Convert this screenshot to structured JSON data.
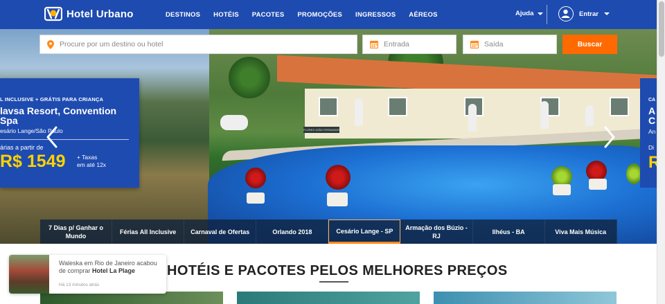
{
  "header": {
    "logo_text": "Hotel Urbano",
    "nav": [
      "DESTINOS",
      "HOTÉIS",
      "PACOTES",
      "PROMOÇÕES",
      "INGRESSOS",
      "AÉREOS"
    ],
    "help_label": "Ajuda",
    "login_label": "Entrar"
  },
  "search": {
    "destination_placeholder": "Procure por um destino ou hotel",
    "checkin_placeholder": "Entrada",
    "checkout_placeholder": "Saída",
    "button_label": "Buscar"
  },
  "promo": {
    "tag": "L INCLUSIVE + GRÁTIS PARA CRIANÇA",
    "name": "lavsa Resort, Convention Spa",
    "location": "esário Lange/São Paulo",
    "from_label": "árias a partir de",
    "price": "R$ 1549",
    "tax_line1": "+ Taxas",
    "tax_line2": "em até 12x"
  },
  "promo_next": {
    "tag": "CA",
    "name": "A C",
    "location": "An",
    "from_label": "Di",
    "price": "R"
  },
  "dest_tabs": [
    {
      "label": "7 Dias p/ Ganhar o Mundo",
      "active": false
    },
    {
      "label": "Férias All Inclusive",
      "active": false
    },
    {
      "label": "Carnaval de Ofertas",
      "active": false
    },
    {
      "label": "Orlando 2018",
      "active": false
    },
    {
      "label": "Cesário Lange - SP",
      "active": true
    },
    {
      "label": "Armação dos Búzio - RJ",
      "active": false
    },
    {
      "label": "Ilhéus - BA",
      "active": false
    },
    {
      "label": "Viva Mais Música",
      "active": false
    }
  ],
  "hero_sign": "FLORES JOÃO FERNANDES",
  "section_title": "HOTÉIS E PACOTES PELOS MELHORES PREÇOS",
  "toast": {
    "text_prefix": "Waleska em Rio de Janeiro acabou de comprar",
    "hotel": "Hotel La Plage",
    "time": "Há 13 minutos atrás"
  },
  "colors": {
    "brand_blue": "#1e4bb0",
    "accent_orange": "#ff6a00",
    "price_yellow": "#ffd200"
  },
  "icons": {
    "destination": "location-pin-icon",
    "checkin": "calendar-icon",
    "checkout": "calendar-icon",
    "user": "user-icon"
  }
}
